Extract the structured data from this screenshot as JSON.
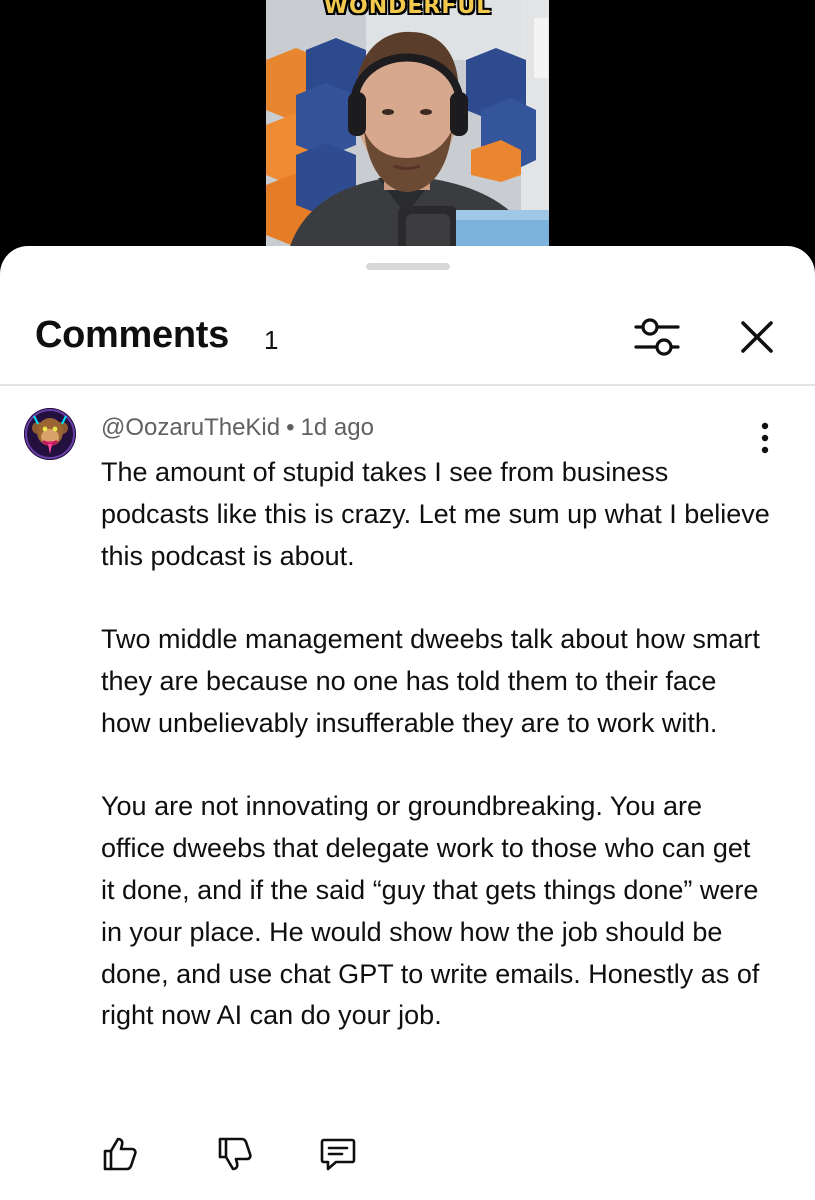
{
  "video": {
    "caption": "WONDERFUL"
  },
  "sheet": {
    "title": "Comments",
    "count": "1"
  },
  "icons": {
    "filter": "tune-icon",
    "close": "close-icon",
    "more": "more-vertical-icon",
    "like": "thumb-up-icon",
    "dislike": "thumb-down-icon",
    "reply": "comment-reply-icon"
  },
  "comment": {
    "author": "@OozaruTheKid",
    "separator": "•",
    "time": "1d ago",
    "paragraphs": [
      "The amount of stupid takes I see from business podcasts like this is crazy. Let me sum up what I believe this podcast is about.",
      "Two middle management dweebs talk about how smart they are because no one has told them to their face how unbelievably insufferable they are to work with.",
      "You are not innovating or groundbreaking. You are office dweebs that delegate work to those who can get it done, and if the said “guy that gets things done” were in your place. He would show how the job should be done, and use chat GPT to write emails. Honestly as of right now AI can do your job."
    ]
  }
}
